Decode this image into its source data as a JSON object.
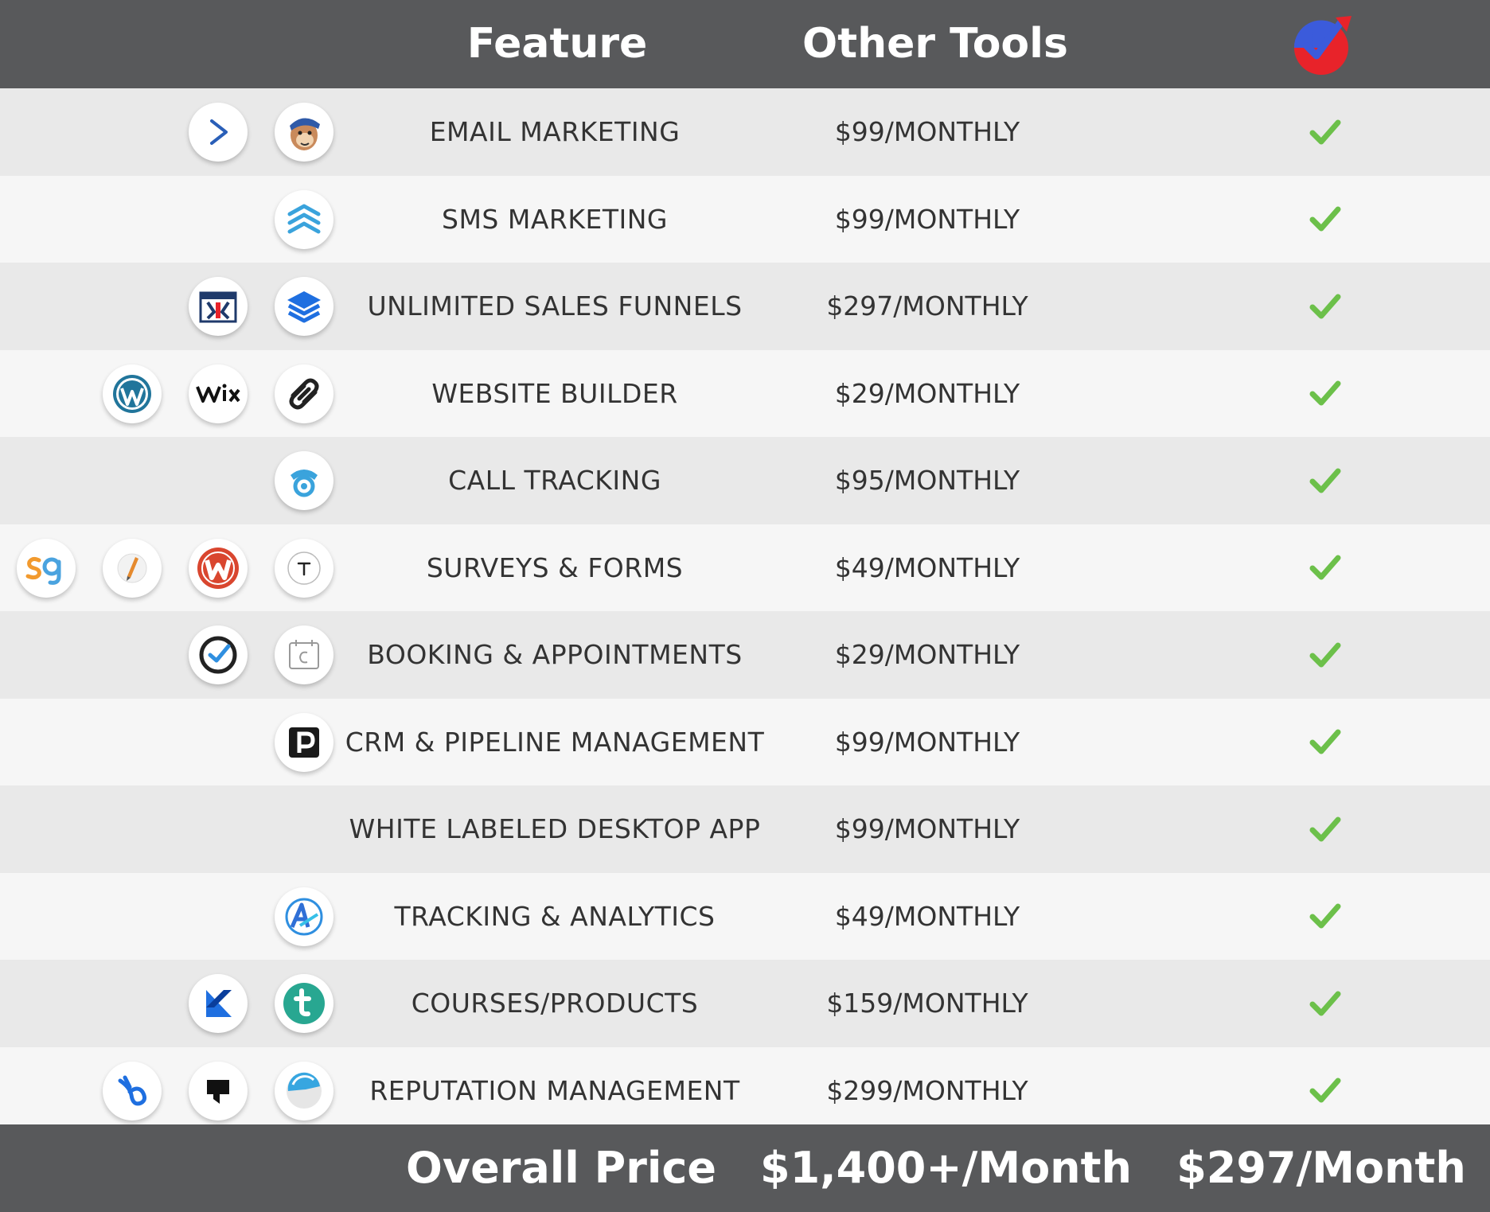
{
  "header": {
    "feature_label": "Feature",
    "other_label": "Other Tools",
    "brand_icon": "brand-logo-icon",
    "brand_colors": {
      "blue": "#3b5bdb",
      "red": "#e8232a"
    }
  },
  "check_color": "#6cc04a",
  "rows": [
    {
      "feature": "EMAIL MARKETING",
      "price": "$99/MONTHLY",
      "icons": [
        "activecampaign-icon",
        "mailchimp-icon"
      ]
    },
    {
      "feature": "SMS MARKETING",
      "price": "$99/MONTHLY",
      "icons": [
        "sms-chevrons-icon"
      ]
    },
    {
      "feature": "UNLIMITED SALES FUNNELS",
      "price": "$297/MONTHLY",
      "icons": [
        "clickfunnels-icon",
        "layers-icon"
      ]
    },
    {
      "feature": "WEBSITE BUILDER",
      "price": "$29/MONTHLY",
      "icons": [
        "wordpress-icon",
        "wix-icon",
        "squarespace-icon"
      ]
    },
    {
      "feature": "CALL TRACKING",
      "price": "$95/MONTHLY",
      "icons": [
        "call-tracking-icon"
      ]
    },
    {
      "feature": "SURVEYS & FORMS",
      "price": "$49/MONTHLY",
      "icons": [
        "surveygizmo-icon",
        "pen-icon",
        "wufoo-icon",
        "typeform-icon"
      ]
    },
    {
      "feature": "BOOKING & APPOINTMENTS",
      "price": "$29/MONTHLY",
      "icons": [
        "acuity-icon",
        "calendly-icon"
      ]
    },
    {
      "feature": "CRM & PIPELINE MANAGEMENT",
      "price": "$99/MONTHLY",
      "icons": [
        "pipedrive-icon"
      ]
    },
    {
      "feature": "WHITE LABELED DESKTOP APP",
      "price": "$99/MONTHLY",
      "icons": []
    },
    {
      "feature": "TRACKING & ANALYTICS",
      "price": "$49/MONTHLY",
      "icons": [
        "analytics-icon"
      ]
    },
    {
      "feature": "COURSES/PRODUCTS",
      "price": "$159/MONTHLY",
      "icons": [
        "kajabi-icon",
        "teachable-icon"
      ]
    },
    {
      "feature": "REPUTATION MANAGEMENT",
      "price": "$299/MONTHLY",
      "icons": [
        "birdeye-icon",
        "podium-icon",
        "reputation-icon"
      ]
    }
  ],
  "footer": {
    "label": "Overall Price",
    "other_total": "$1,400+/Month",
    "our_total": "$297/Month"
  }
}
